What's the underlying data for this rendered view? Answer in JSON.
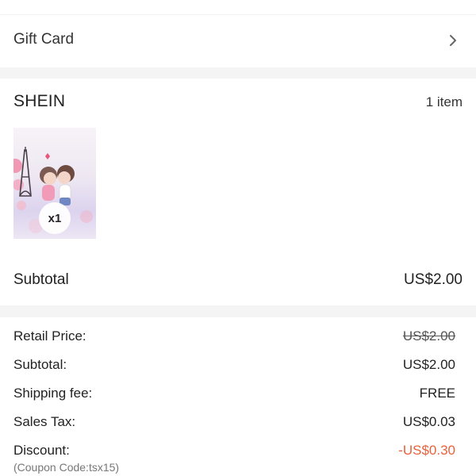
{
  "gift_card": {
    "label": "Gift Card"
  },
  "store": {
    "name": "SHEIN",
    "item_count": "1 item",
    "product": {
      "quantity_badge": "x1"
    },
    "subtotal_label": "Subtotal",
    "subtotal_value": "US$2.00"
  },
  "summary": {
    "rows": [
      {
        "label": "Retail Price:",
        "value": "US$2.00"
      },
      {
        "label": "Subtotal:",
        "value": "US$2.00"
      },
      {
        "label": "Shipping fee:",
        "value": "FREE"
      },
      {
        "label": "Sales Tax:",
        "value": "US$0.03"
      },
      {
        "label": "Discount:",
        "value": "-US$0.30"
      }
    ],
    "coupon_note": "(Coupon Code:tsx15)"
  },
  "colors": {
    "background": "#f4f4f4",
    "card": "#ffffff",
    "discount": "#e8613c"
  },
  "icons": {
    "gift_card_chevron": "chevron-right-icon"
  }
}
